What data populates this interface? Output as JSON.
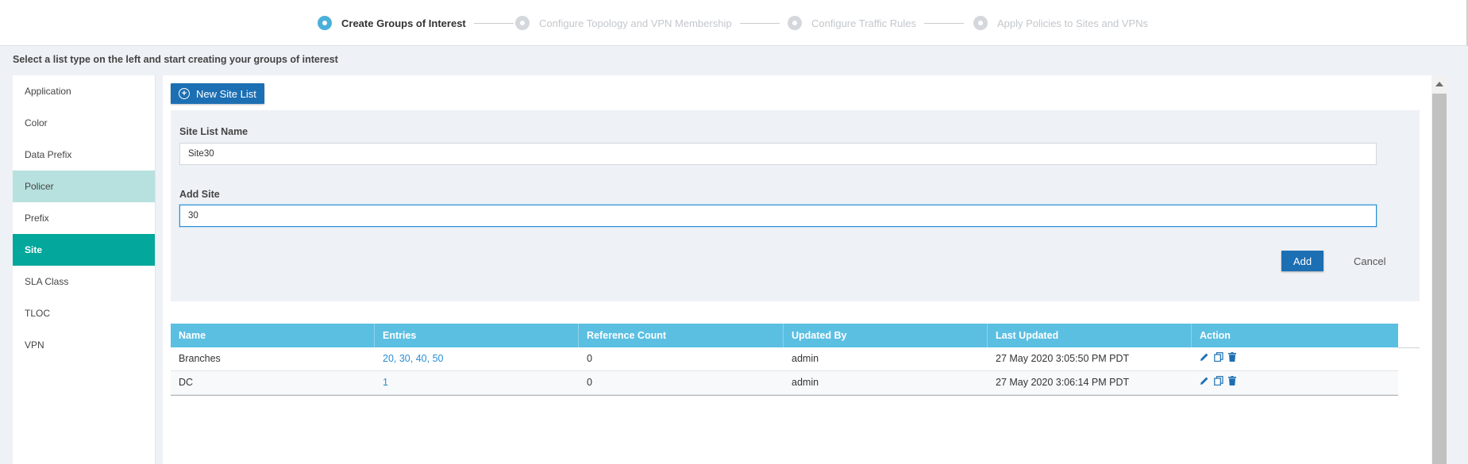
{
  "wizard": {
    "steps": [
      {
        "label": "Create Groups of Interest",
        "state": "active"
      },
      {
        "label": "Configure Topology and VPN Membership",
        "state": "inactive"
      },
      {
        "label": "Configure Traffic Rules",
        "state": "inactive"
      },
      {
        "label": "Apply Policies to Sites and VPNs",
        "state": "inactive"
      }
    ]
  },
  "instruction": "Select a list type on the left and start creating your groups of interest",
  "leftnav": {
    "items": [
      {
        "label": "Application"
      },
      {
        "label": "Color"
      },
      {
        "label": "Data Prefix"
      },
      {
        "label": "Policer"
      },
      {
        "label": "Prefix"
      },
      {
        "label": "Site"
      },
      {
        "label": "SLA Class"
      },
      {
        "label": "TLOC"
      },
      {
        "label": "VPN"
      }
    ],
    "hovered": "Policer",
    "selected": "Site"
  },
  "toolbar": {
    "new_button_label": "New Site List"
  },
  "form": {
    "site_list_name_label": "Site List Name",
    "site_list_name_value": "Site30",
    "add_site_label": "Add Site",
    "add_site_value": "30",
    "add_button": "Add",
    "cancel_button": "Cancel"
  },
  "table": {
    "columns": [
      "Name",
      "Entries",
      "Reference Count",
      "Updated By",
      "Last Updated",
      "Action"
    ],
    "rows": [
      {
        "name": "Branches",
        "entries": [
          "20",
          "30",
          "40",
          "50"
        ],
        "reference_count": "0",
        "updated_by": "admin",
        "last_updated": "27 May 2020 3:05:50 PM PDT"
      },
      {
        "name": "DC",
        "entries": [
          "1"
        ],
        "reference_count": "0",
        "updated_by": "admin",
        "last_updated": "27 May 2020 3:06:14 PM PDT"
      }
    ],
    "action_icons": [
      "edit-icon",
      "copy-icon",
      "delete-icon"
    ]
  },
  "colors": {
    "accent_teal": "#03a79b",
    "hover_teal": "#b7e1de",
    "primary_blue": "#1c6fb3",
    "table_header": "#5bbfe2",
    "link_blue": "#2a8dd4",
    "step_active": "#4ab0da"
  }
}
